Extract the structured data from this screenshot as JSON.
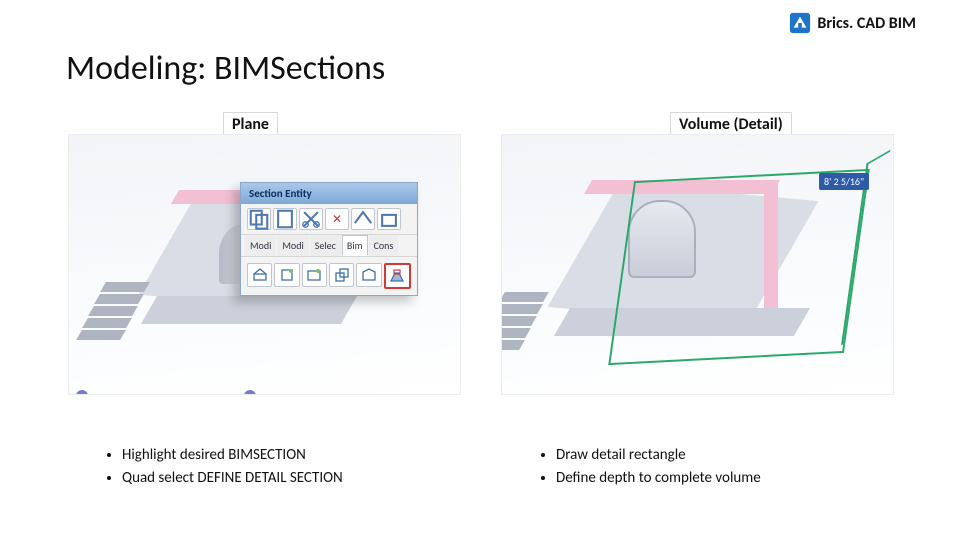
{
  "brand": {
    "name": "Brics. CAD BIM"
  },
  "title": "Modeling: BIMSections",
  "columns": {
    "left": {
      "label": "Plane",
      "bullets": [
        "Highlight desired BIMSECTION",
        "Quad select DEFINE DETAIL SECTION"
      ]
    },
    "right": {
      "label": "Volume (Detail)",
      "bullets": [
        "Draw detail rectangle",
        "Define depth to complete volume"
      ],
      "dimension": "8' 2 5/16\""
    }
  },
  "popup": {
    "title": "Section Entity",
    "tabs": [
      "Modi",
      "Modi",
      "Selec",
      "Bim",
      "Cons"
    ],
    "selected_tab": 3,
    "highlight_icon": "define-detail-section-icon"
  }
}
